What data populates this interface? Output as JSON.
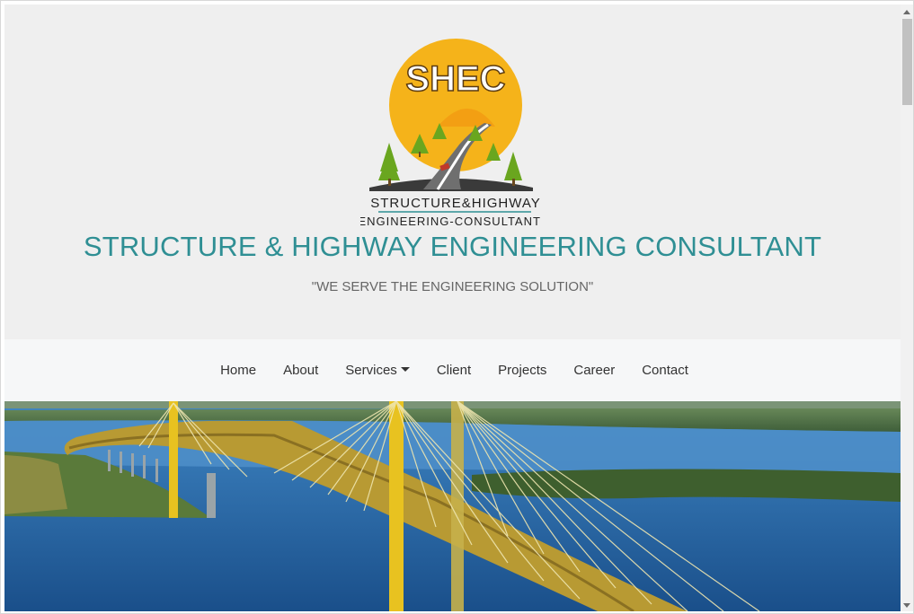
{
  "logo": {
    "text_top": "SHEC",
    "text_mid": "STRUCTURE&HIGHWAY",
    "text_bottom": "ENGINEERING-CONSULTANTS"
  },
  "header": {
    "title": "STRUCTURE & HIGHWAY ENGINEERING CONSULTANT",
    "tagline": "\"WE SERVE THE ENGINEERING SOLUTION\""
  },
  "nav": {
    "items": [
      {
        "label": "Home"
      },
      {
        "label": "About"
      },
      {
        "label": "Services"
      },
      {
        "label": "Client"
      },
      {
        "label": "Projects"
      },
      {
        "label": "Career"
      },
      {
        "label": "Contact"
      }
    ]
  },
  "colors": {
    "title": "#2f8f94",
    "sun": "#f5b31a",
    "water": "#1f5f9c",
    "pylon": "#e8c220"
  },
  "icons": {
    "services_dropdown": "caret-down-icon",
    "scroll_up": "scroll-up-arrow-icon",
    "scroll_down": "scroll-down-arrow-icon"
  }
}
